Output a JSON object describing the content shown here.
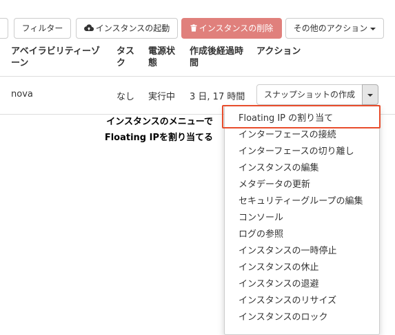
{
  "toolbar": {
    "filter_label": "フィルター",
    "launch_label": "インスタンスの起動",
    "delete_label": "インスタンスの削除",
    "more_label": "その他のアクション",
    "delete_color": "#e0807c"
  },
  "table": {
    "headers": {
      "az_line1": "アベイラビリティーゾ",
      "az_line2": "ーン",
      "task_line1": "タス",
      "task_line2": "ク",
      "power_line1": "電源状",
      "power_line2": "態",
      "age_line1": "作成後経過時",
      "age_line2": "間",
      "action": "アクション"
    },
    "row": {
      "az": "nova",
      "task": "なし",
      "power": "実行中",
      "age": "3 日, 17 時間",
      "action_main": "スナップショットの作成"
    }
  },
  "annotation": {
    "line1": "インスタンスのメニューで",
    "line2": "Floating IPを割り当てる",
    "highlight_color": "#e84c2b"
  },
  "menu": {
    "items": [
      "Floating IP の割り当て",
      "インターフェースの接続",
      "インターフェースの切り離し",
      "インスタンスの編集",
      "メタデータの更新",
      "セキュリティーグループの編集",
      "コンソール",
      "ログの参照",
      "インスタンスの一時停止",
      "インスタンスの休止",
      "インスタンスの退避",
      "インスタンスのリサイズ",
      "インスタンスのロック"
    ]
  }
}
